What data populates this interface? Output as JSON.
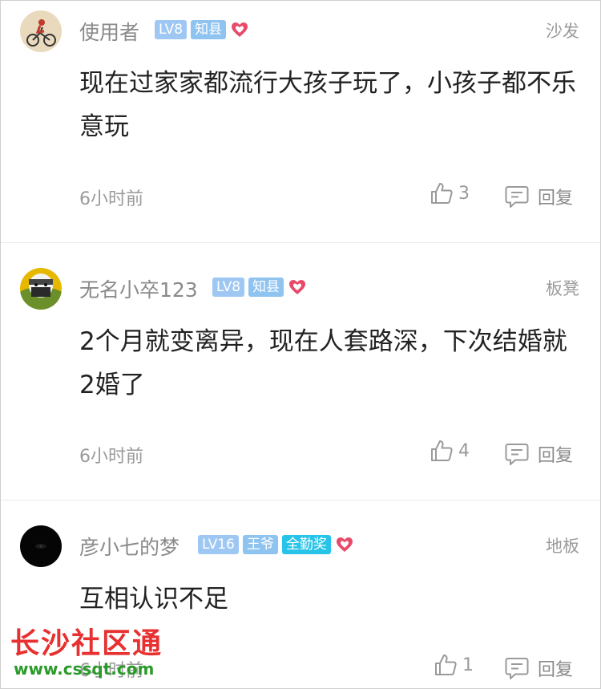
{
  "comments": [
    {
      "username": "使用者",
      "badges": [
        "LV8",
        "知县"
      ],
      "floor": "沙发",
      "text": "现在过家家都流行大孩子玩了，小孩子都不乐意玩",
      "time": "6小时前",
      "likes": "3",
      "reply_label": "回复",
      "avatar_icon": "cyclist-avatar"
    },
    {
      "username": "无名小卒123",
      "badges": [
        "LV8",
        "知县"
      ],
      "floor": "板凳",
      "text": "2个月就变离异，现在人套路深，下次结婚就2婚了",
      "time": "6小时前",
      "likes": "4",
      "reply_label": "回复",
      "avatar_icon": "ninja-avatar"
    },
    {
      "username": "彦小七的梦",
      "badges": [
        "LV16",
        "王爷",
        "全勤奖"
      ],
      "floor": "地板",
      "text": "互相认识不足",
      "time": "6小时前",
      "likes": "1",
      "reply_label": "回复",
      "avatar_icon": "eye-avatar"
    }
  ],
  "watermark": {
    "title": "长沙社区通",
    "url": "www.cssqt.com"
  },
  "colors": {
    "heart": "#e84a6a",
    "badge_lv": "#9ec8f3",
    "badge_award": "#27c3e8",
    "watermark_red": "#e83030",
    "watermark_green": "#2a9a2a"
  }
}
